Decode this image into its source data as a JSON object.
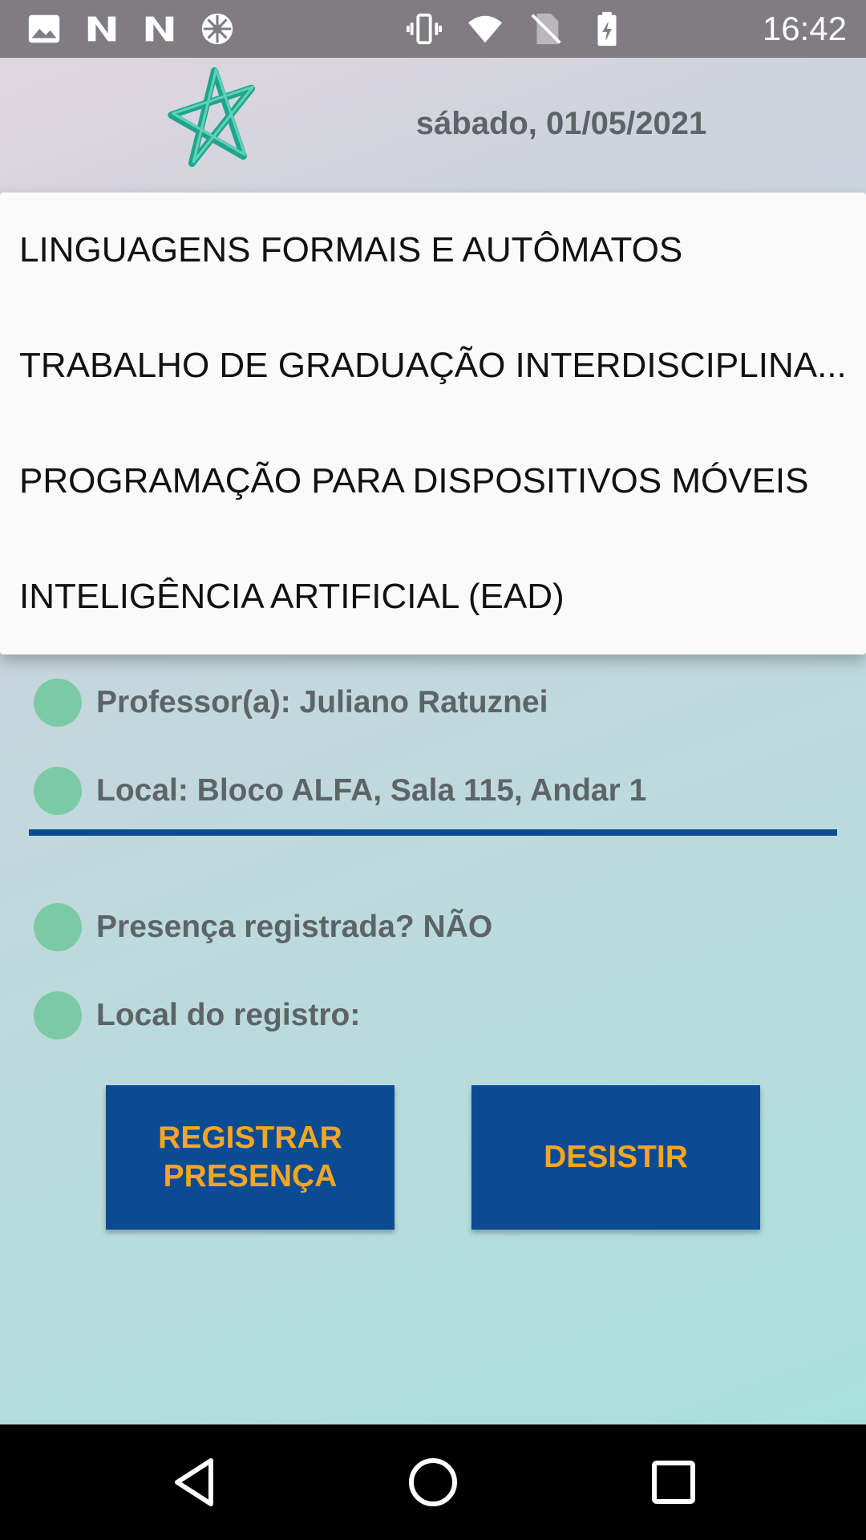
{
  "status_bar": {
    "time": "16:42",
    "left_icons": [
      "image-notification-icon",
      "n-notification-icon",
      "n-notification-icon",
      "sync-wheel-icon"
    ],
    "right_icons": [
      "vibrate-icon",
      "wifi-icon",
      "no-sim-icon",
      "battery-charging-icon"
    ]
  },
  "header": {
    "logo": "star-logo-icon",
    "date": "sábado, 01/05/2021"
  },
  "dropdown": {
    "items": [
      "LINGUAGENS FORMAIS E AUTÔMATOS",
      "TRABALHO DE GRADUAÇÃO INTERDISCIPLINA...",
      "PROGRAMAÇÃO PARA DISPOSITIVOS MÓVEIS",
      "INTELIGÊNCIA ARTIFICIAL (EAD)"
    ]
  },
  "details": {
    "professor": "Professor(a): Juliano Ratuznei",
    "local": "Local: Bloco ALFA, Sala 115, Andar 1",
    "presence": "Presença registrada? NÃO",
    "register_location": "Local do registro:"
  },
  "buttons": {
    "register": "REGISTRAR\nPRESENÇA",
    "cancel": "DESISTIR"
  },
  "colors": {
    "accent_blue": "#0a4b94",
    "button_text": "#f5a623",
    "dot_green": "#7ccaa5",
    "logo_teal": "#1fa58c"
  }
}
